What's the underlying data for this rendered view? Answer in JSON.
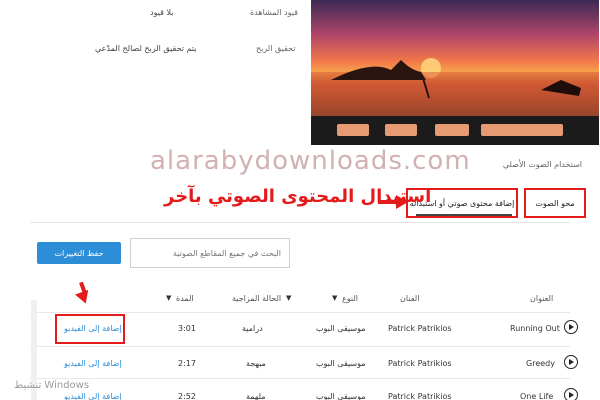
{
  "settings": {
    "restrictions_label": "قيود المشاهدة",
    "restrictions_value": "بلا قيود",
    "monetization_label": "تحقيق الربح",
    "monetization_value": "يتم تحقيق الربح لصالح المدّعي"
  },
  "watermark": "alarabydownloads.com",
  "audio": {
    "original_audio_label": "استخدام الصوت الأصلي",
    "tab_remove_audio": "محو الصوت",
    "tab_add_replace": "إضافة محتوى صوتي أو استبداله",
    "annotation": "استبدال المحتوى الصوتي بآخر"
  },
  "toolbar": {
    "save_label": "حفظ التغييرات",
    "search_placeholder": "البحث في جميع المقاطع الصوتية"
  },
  "table": {
    "headers": {
      "title": "العنوان",
      "artist": "الفنان",
      "genre": "النوع",
      "mood": "الحالة المزاجية",
      "duration": "المدة"
    },
    "rows": [
      {
        "title": "Running Out",
        "artist": "Patrick Patrikios",
        "genre": "موسيقى البوب",
        "mood": "درامية",
        "duration": "3:01",
        "action": "إضافة إلى الفيديو"
      },
      {
        "title": "Greedy",
        "artist": "Patrick Patrikios",
        "genre": "موسيقى البوب",
        "mood": "مبهجة",
        "duration": "2:17",
        "action": "إضافة إلى الفيديو"
      },
      {
        "title": "One Life",
        "artist": "Patrick Patrikios",
        "genre": "موسيقى البوب",
        "mood": "ملهمة",
        "duration": "2:52",
        "action": "إضافة إلى الفيديو"
      }
    ]
  },
  "os_overlay": {
    "activate_windows": "تنشيط Windows"
  },
  "colors": {
    "accent_blue": "#2d8ed8",
    "annotation_red": "#e31b1b",
    "player_button": "#e79b72"
  }
}
